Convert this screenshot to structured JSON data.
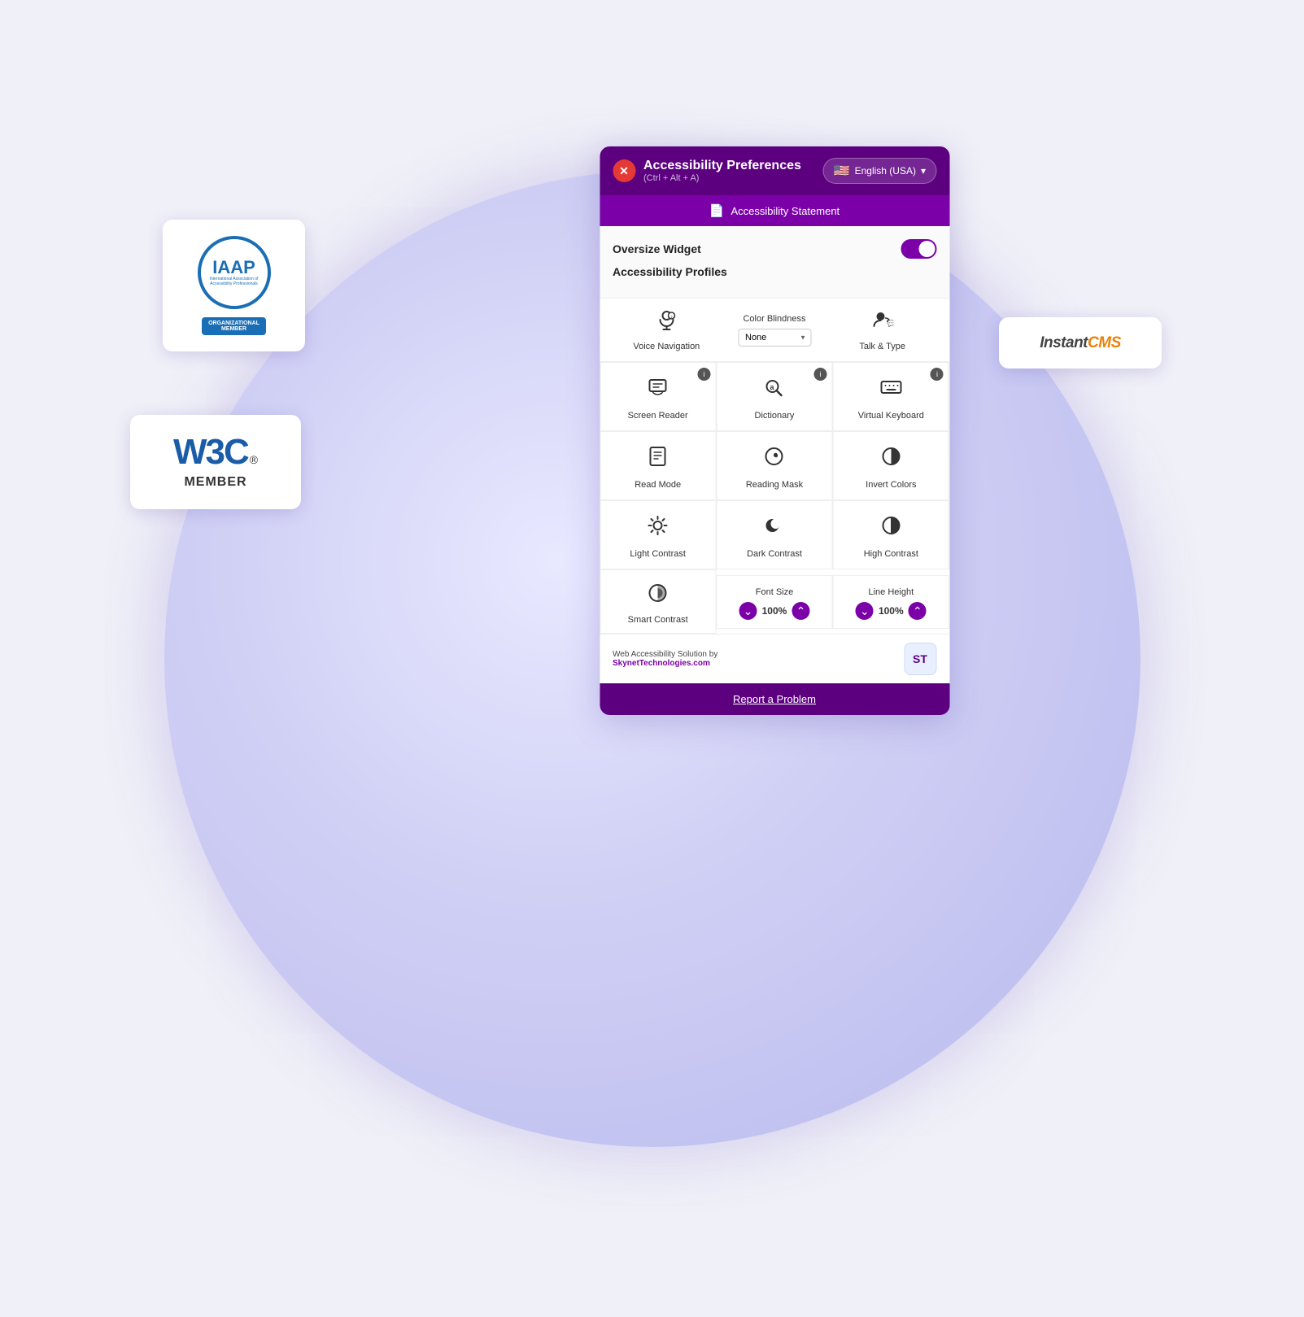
{
  "page": {
    "background_circle_color": "#d0d0f5"
  },
  "header": {
    "title": "Accessibility Preferences",
    "shortcut": "(Ctrl + Alt + A)",
    "close_label": "×",
    "language": "English (USA)"
  },
  "statement_bar": {
    "label": "Accessibility Statement",
    "icon": "document-icon"
  },
  "settings": {
    "oversize_widget_label": "Oversize Widget",
    "profiles_label": "Accessibility Profiles"
  },
  "top_features": [
    {
      "id": "voice-navigation",
      "label": "Voice Navigation",
      "icon": "mic-icon"
    },
    {
      "id": "color-blindness",
      "label": "Color Blindness",
      "dropdown_default": "None"
    },
    {
      "id": "talk-and-type",
      "label": "Talk & Type",
      "icon": "talk-icon"
    }
  ],
  "feature_tiles": [
    {
      "id": "screen-reader",
      "label": "Screen Reader",
      "icon": "screen-reader-icon",
      "has_info": true
    },
    {
      "id": "dictionary",
      "label": "Dictionary",
      "icon": "dictionary-icon",
      "has_info": true
    },
    {
      "id": "virtual-keyboard",
      "label": "Virtual Keyboard",
      "icon": "keyboard-icon",
      "has_info": true
    },
    {
      "id": "read-mode",
      "label": "Read Mode",
      "icon": "read-mode-icon",
      "has_info": false
    },
    {
      "id": "reading-mask",
      "label": "Reading Mask",
      "icon": "reading-mask-icon",
      "has_info": false
    },
    {
      "id": "invert-colors",
      "label": "Invert Colors",
      "icon": "invert-icon",
      "has_info": false
    },
    {
      "id": "light-contrast",
      "label": "Light Contrast",
      "icon": "light-contrast-icon",
      "has_info": false
    },
    {
      "id": "dark-contrast",
      "label": "Dark Contrast",
      "icon": "dark-contrast-icon",
      "has_info": false
    },
    {
      "id": "high-contrast",
      "label": "High Contrast",
      "icon": "high-contrast-icon",
      "has_info": false
    }
  ],
  "stepper_tiles": [
    {
      "id": "smart-contrast",
      "label": "Smart Contrast",
      "icon": "smart-contrast-icon",
      "type": "icon-only"
    },
    {
      "id": "font-size",
      "label": "Font Size",
      "value": "100%",
      "type": "stepper"
    },
    {
      "id": "line-height",
      "label": "Line Height",
      "value": "100%",
      "type": "stepper"
    }
  ],
  "footer": {
    "text_line1": "Web Accessibility Solution by",
    "text_line2": "SkynetTechnologies.com",
    "logo_text": "ST"
  },
  "report_btn": {
    "label": "Report a Problem"
  },
  "iaap_card": {
    "acronym": "IAAP",
    "full_name": "International Association of Accessibility Professionals",
    "badge_line1": "ORGANIZATIONAL",
    "badge_line2": "MEMBER"
  },
  "w3c_card": {
    "text": "W3C",
    "superscript": "®",
    "member_label": "MEMBER"
  },
  "instantcms_card": {
    "text": "InstantCMS"
  }
}
